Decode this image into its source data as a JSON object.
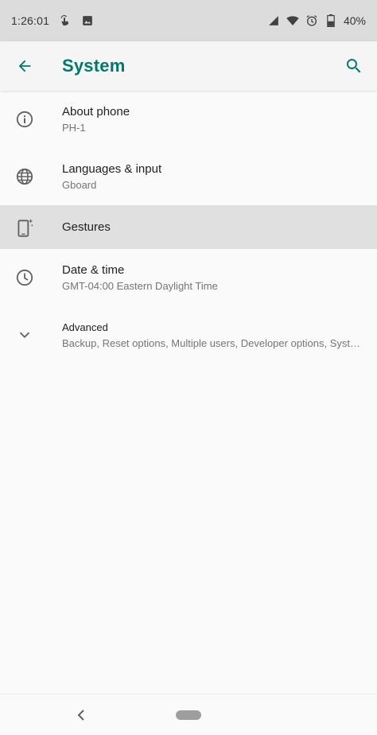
{
  "status_bar": {
    "time": "1:26:01",
    "battery": "40%",
    "icons": [
      "touch-icon",
      "image-icon",
      "signal-icon",
      "wifi-icon",
      "alarm-icon",
      "battery-icon"
    ]
  },
  "app_bar": {
    "title": "System",
    "accent_color": "#00796b"
  },
  "settings": [
    {
      "title": "About phone",
      "subtitle": "PH-1",
      "icon": "info-icon"
    },
    {
      "title": "Languages & input",
      "subtitle": "Gboard",
      "icon": "globe-icon"
    },
    {
      "title": "Gestures",
      "subtitle": "",
      "icon": "gestures-phone-icon",
      "highlighted": true
    },
    {
      "title": "Date & time",
      "subtitle": "GMT-04:00 Eastern Daylight Time",
      "icon": "clock-icon"
    },
    {
      "title": "Advanced",
      "subtitle": "Backup, Reset options, Multiple users, Developer options, System updates",
      "icon": "chevron-down-icon"
    }
  ],
  "nav_bar": {
    "icons": [
      "back-icon",
      "home-pill"
    ]
  }
}
